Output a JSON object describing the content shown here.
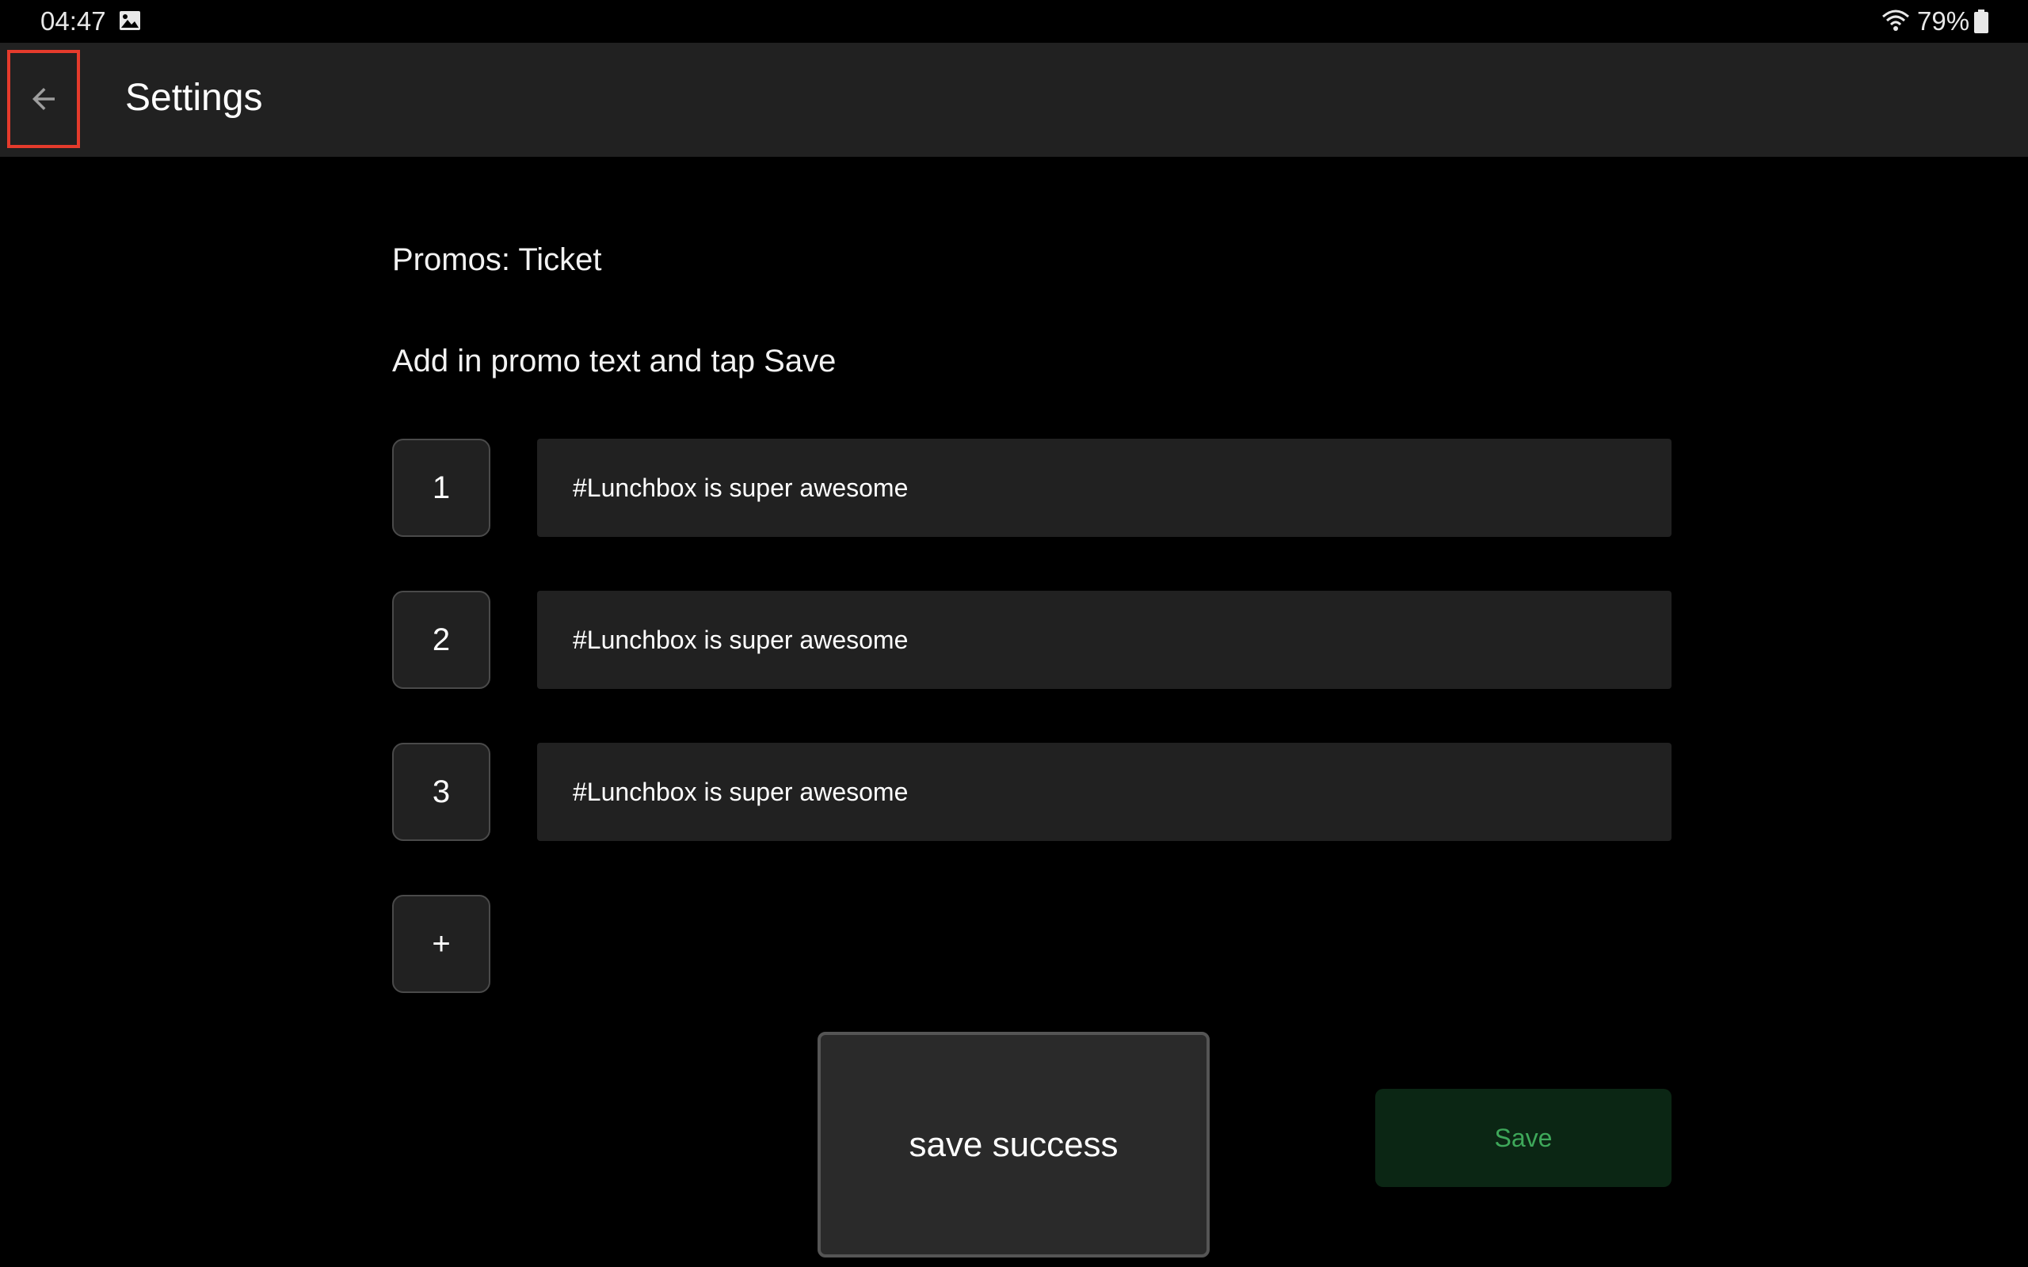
{
  "status_bar": {
    "time": "04:47",
    "battery": "79%",
    "icons": [
      "image-notification-icon",
      "wifi-icon",
      "battery-icon"
    ]
  },
  "app_bar": {
    "title": "Settings",
    "back_icon": "arrow-back-icon"
  },
  "content": {
    "section_title": "Promos: Ticket",
    "instructions": "Add in promo text and tap Save",
    "promos": [
      {
        "index": "1",
        "value": "#Lunchbox is super awesome"
      },
      {
        "index": "2",
        "value": "#Lunchbox is super awesome"
      },
      {
        "index": "3",
        "value": "#Lunchbox is super awesome"
      }
    ],
    "add_label": "+",
    "toast": "save success",
    "save_label": "Save"
  },
  "colors": {
    "background": "#000000",
    "surface": "#212121",
    "highlight_border": "#e53b2c",
    "save_bg": "#0b2614",
    "save_text": "#3ea85a"
  }
}
